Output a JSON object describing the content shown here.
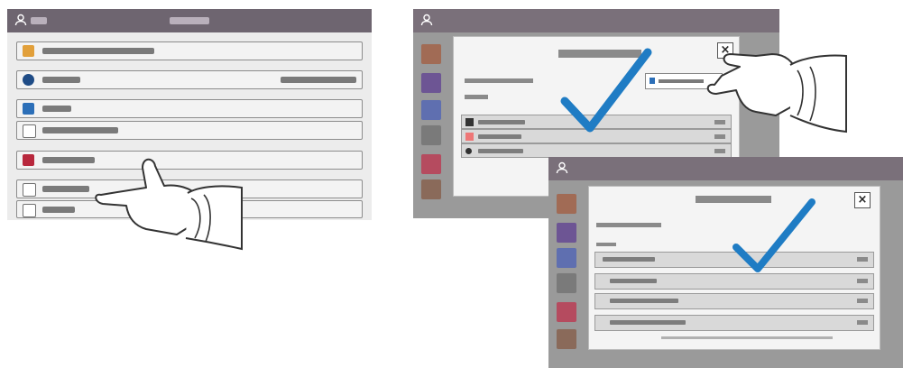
{
  "colors": {
    "header_bar": "#6e6570",
    "check_mark": "#1f7cc4",
    "row_border": "#8c8c8c",
    "dialog_bg": "#f4f4f4"
  },
  "panel_left": {
    "rows": [
      {
        "icon": "wrench-icon",
        "icon_color": "#e2a03b"
      },
      {
        "icon": "gear-icon",
        "icon_color": "#1f4c86"
      },
      {
        "icon": "document-icon",
        "icon_color": "#2c6fb8"
      },
      {
        "icon": "copy-icon",
        "icon_color": "#707070"
      },
      {
        "icon": "folder-icon",
        "icon_color": "#b8283d"
      },
      {
        "icon": "list-icon",
        "icon_color": "#707070"
      },
      {
        "icon": "print-icon",
        "icon_color": "#707070"
      }
    ]
  },
  "panel_mid": {
    "close_label": "×",
    "tiles": [
      "#a16b55",
      "#6d5594",
      "#5f6fb0",
      "#7a7a7a",
      "#b54b5f",
      "#8a6a5a"
    ]
  },
  "panel_right": {
    "close_label": "×",
    "tiles": [
      "#a16b55",
      "#6d5594",
      "#5f6fb0",
      "#7a7a7a",
      "#b54b5f",
      "#8a6a5a"
    ]
  }
}
